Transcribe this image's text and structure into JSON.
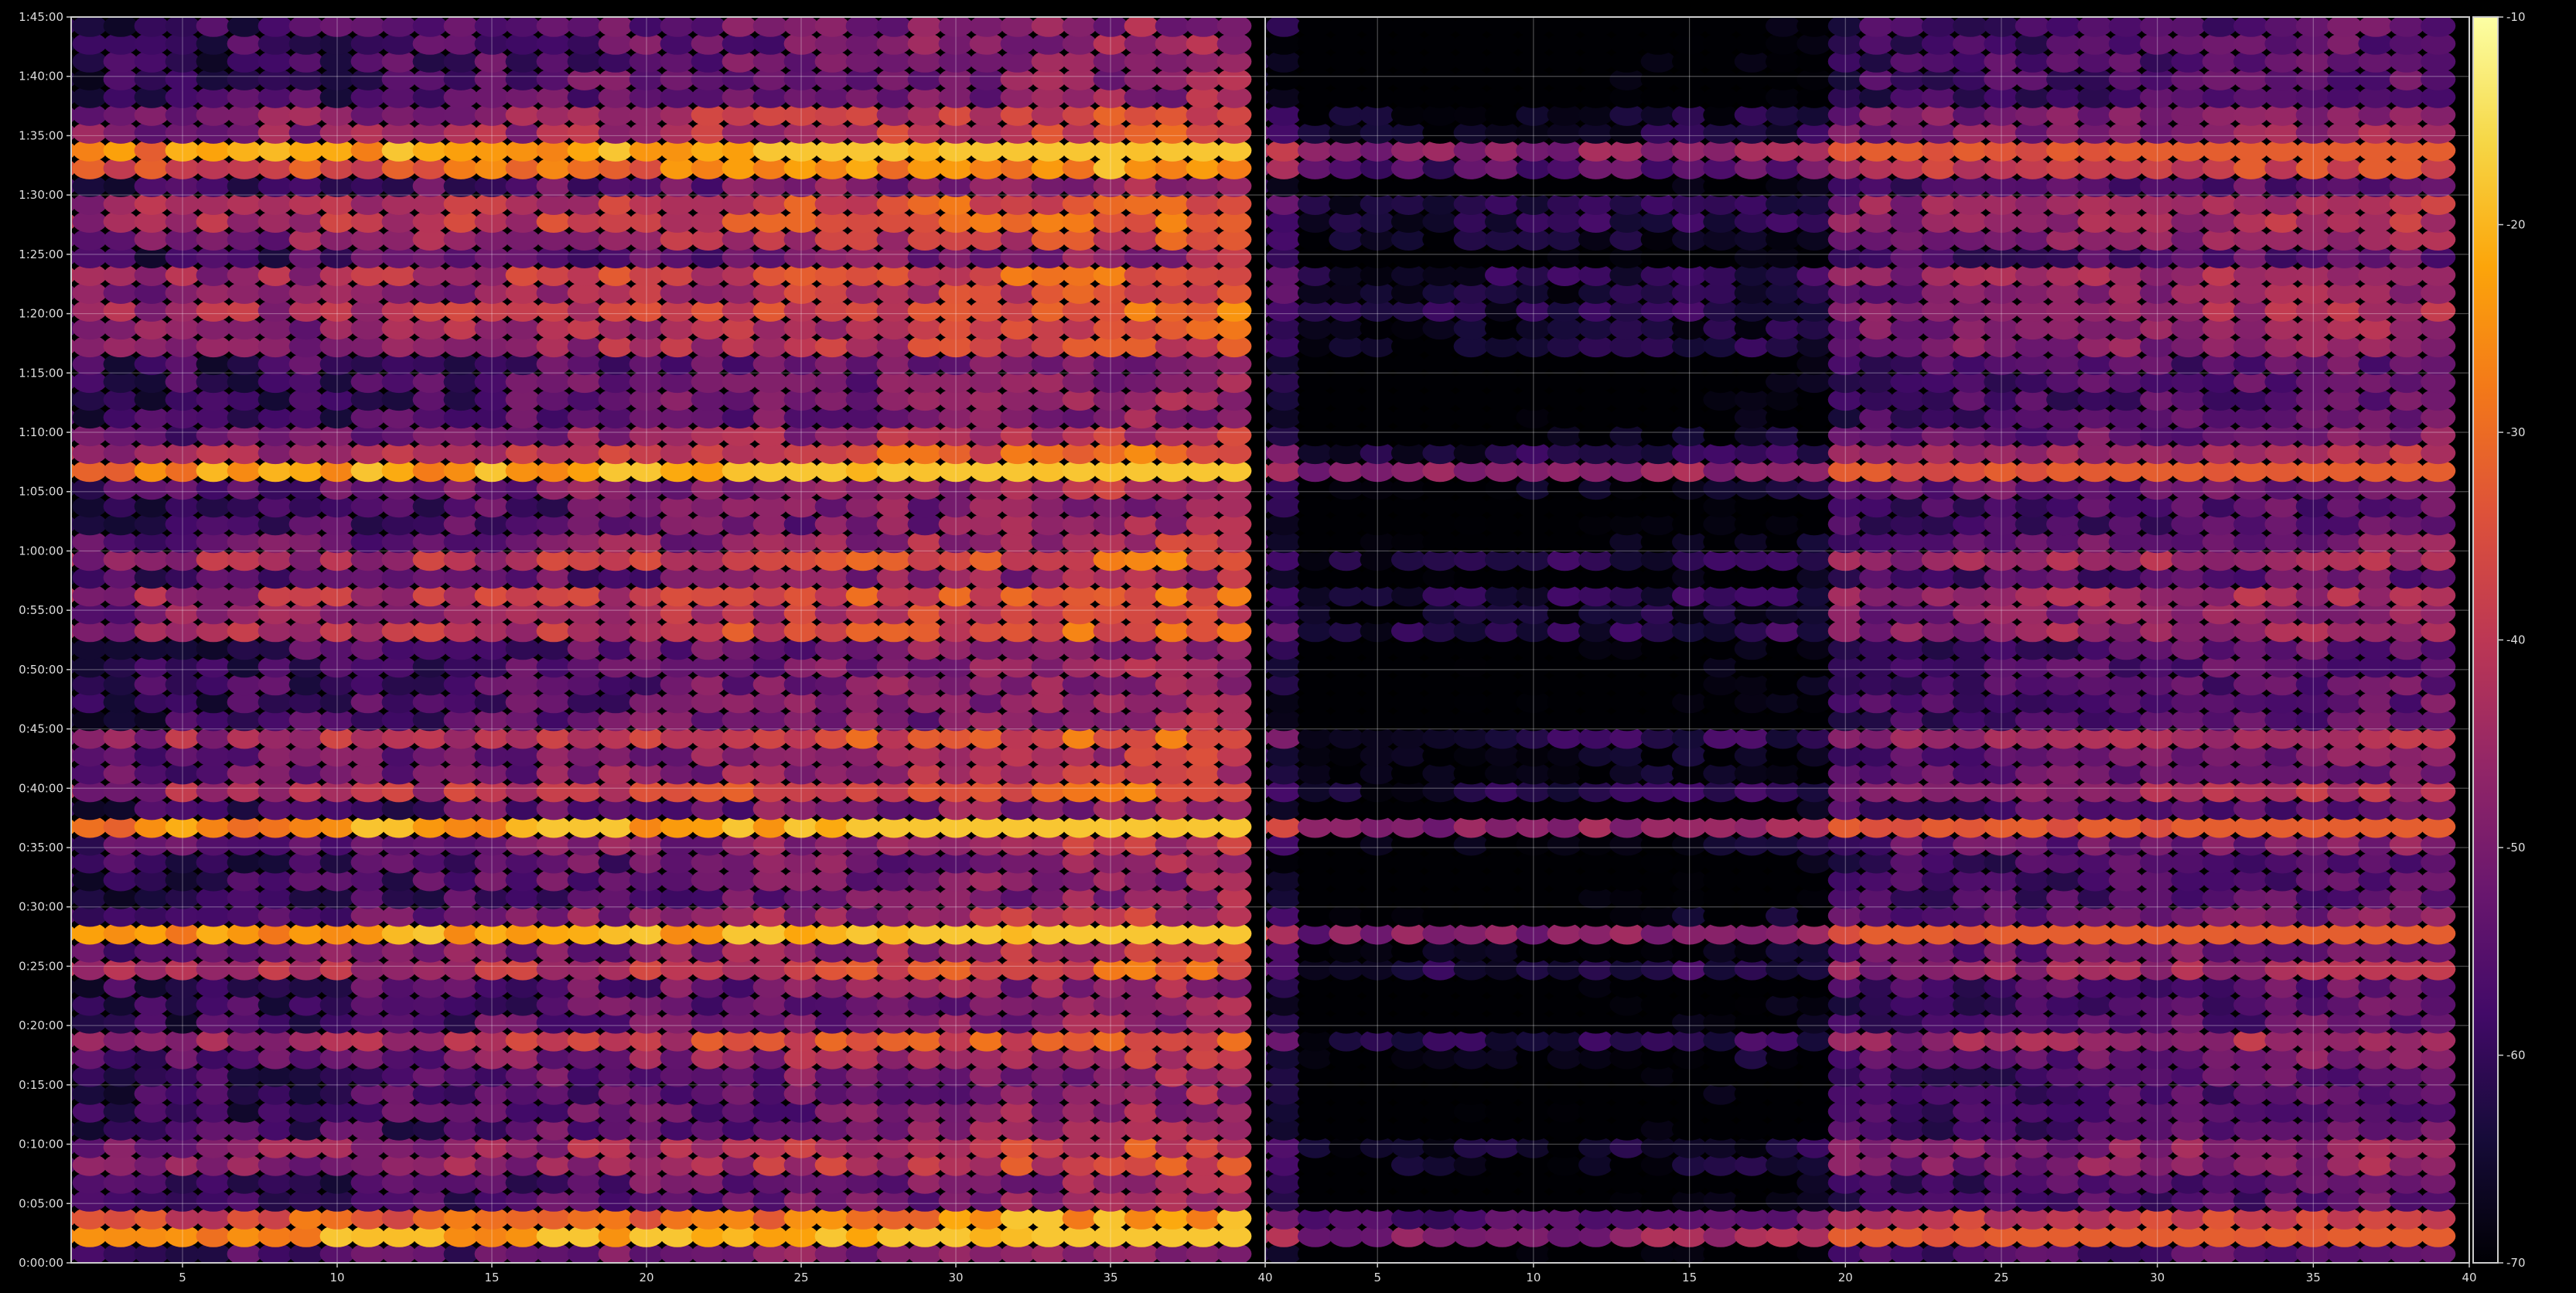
{
  "chart_data": [
    {
      "type": "heatmap",
      "panel": "left",
      "x": {
        "ticks": [
          5,
          10,
          15,
          20,
          25,
          30,
          35,
          40
        ],
        "range": [
          1.4,
          40
        ]
      },
      "y": {
        "ticks": [
          "0:00:00",
          "0:05:00",
          "0:10:00",
          "0:15:00",
          "0:20:00",
          "0:25:00",
          "0:30:00",
          "0:35:00",
          "0:40:00",
          "0:45:00",
          "0:50:00",
          "0:55:00",
          "1:00:00",
          "1:05:00",
          "1:10:00",
          "1:15:00",
          "1:20:00",
          "1:25:00",
          "1:30:00",
          "1:35:00",
          "1:40:00",
          "1:45:00"
        ],
        "range_minutes": [
          0,
          105
        ]
      },
      "cells": {
        "columns": 39,
        "rows": 70,
        "x_start": 1,
        "x_step": 1,
        "y_step_minutes": 1.5
      },
      "intensity_range": [
        -68,
        -18
      ],
      "bright_rows_minutes": [
        3,
        28,
        37,
        66.5,
        93
      ],
      "strong_bands_minutes": [
        2.5,
        9,
        18.5,
        25,
        28,
        36.5,
        40,
        44,
        53.5,
        56,
        59.5,
        66.5,
        68.5,
        78,
        80.5,
        83,
        87,
        89,
        93.5,
        96
      ]
    },
    {
      "type": "heatmap",
      "panel": "right",
      "x": {
        "ticks": [
          5,
          10,
          15,
          20,
          25,
          30,
          35,
          40
        ],
        "range": [
          1.4,
          40
        ]
      },
      "cells": {
        "columns": 39,
        "rows": 70,
        "x_start": 1,
        "x_step": 1,
        "y_step_minutes": 1.5
      },
      "intensity_range": [
        -70,
        -32
      ],
      "dark_column_range": [
        3,
        19
      ],
      "bright_rows_minutes": [
        3,
        28,
        37,
        66.5,
        93
      ]
    }
  ],
  "colorbar": {
    "colormap": "inferno",
    "range": [
      -70,
      -10
    ],
    "ticks": [
      "-10",
      "-20",
      "-30",
      "-40",
      "-50",
      "-60",
      "-70"
    ]
  },
  "colors": {
    "background": "#000000",
    "axis": "#cccccc",
    "grid": "#ffffff",
    "tick_text": "#dddddd"
  }
}
